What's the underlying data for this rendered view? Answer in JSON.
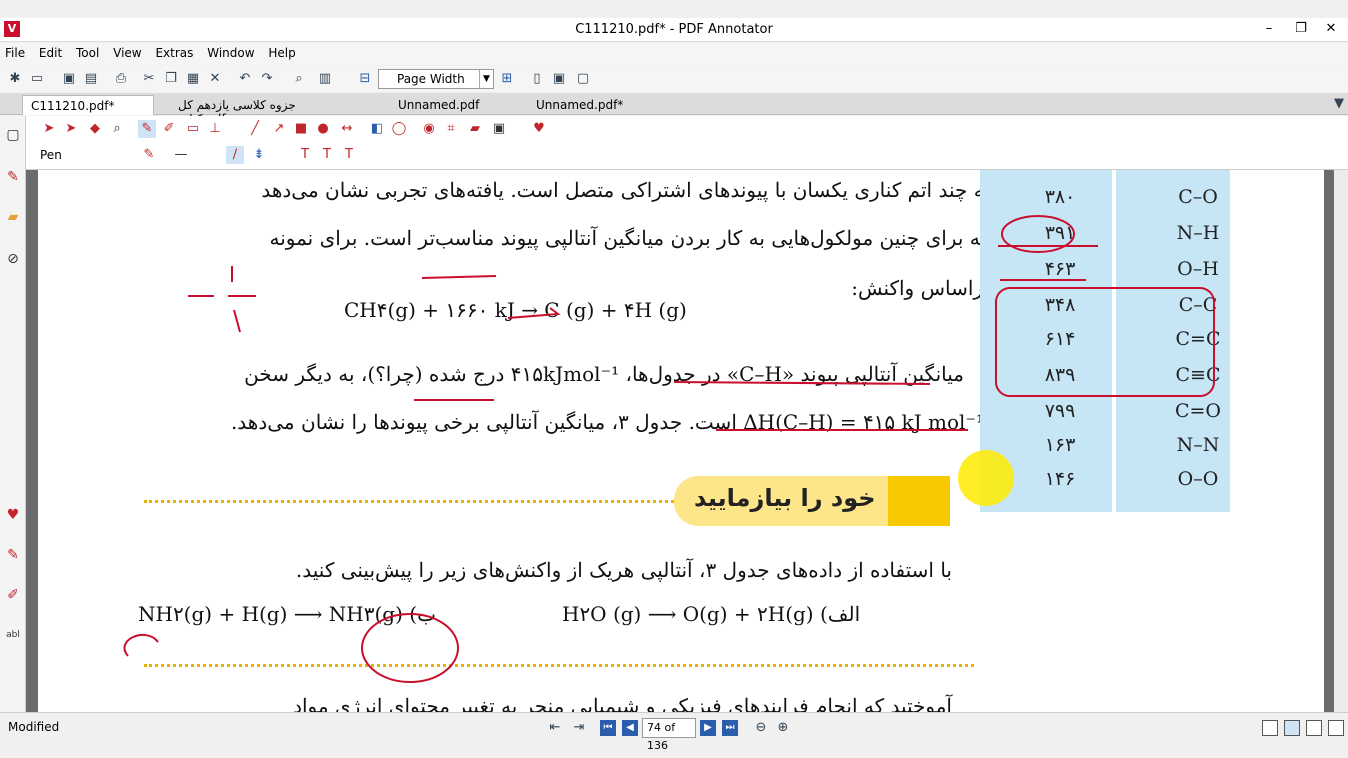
{
  "window": {
    "title": "C111210.pdf* - PDF Annotator",
    "minimize": "–",
    "maximize": "❐",
    "close": "✕"
  },
  "menu": [
    "File",
    "Edit",
    "Tool",
    "View",
    "Extras",
    "Window",
    "Help"
  ],
  "toolbar": {
    "zoom_value": "Page Width"
  },
  "tabs": [
    {
      "label": "C111210.pdf*",
      "active": true
    },
    {
      "label": "جزوه کلاسی یازدهم کل کتاب.pdf",
      "active": false
    },
    {
      "label": "Unnamed.pdf",
      "active": false
    },
    {
      "label": "Unnamed.pdf*",
      "active": false
    }
  ],
  "tool_label": "Pen",
  "page": {
    "line1": "به چند اتم کناری یکسان با پیوندهای اشتراکی متصل است. یافته‌های تجربی نشان می‌دهد",
    "line2": "که برای چنین مولکول‌هایی به کار بردن میانگین آنتالپی پیوند مناسب‌تر است. برای نمونه",
    "line3": "براساس واکنش:",
    "equation1": "CH۴(g) + ۱۶۶۰ kJ → C (g) + ۴H (g)",
    "line4": "میانگین آنتالپی پیوند «C–H» در جدول‌ها، ۴۱۵kJmol⁻¹ درج شده (چرا؟)، به دیگر سخن",
    "line5": "ΔH(C–H) = ۴۱۵ kJ mol⁻¹ است. جدول ۳، میانگین آنتالپی برخی پیوندها را نشان می‌دهد.",
    "banner": "خود را بیازمایید",
    "line6": "با استفاده از داده‌های جدول ۳، آنتالپی هریک از واکنش‌های زیر را پیش‌بینی کنید.",
    "eq_b": "NH۲(g) + H(g) ⟶ NH۳(g) (ب",
    "eq_a": "H۲O (g) ⟶ O(g) + ۲H(g) (الف",
    "line7": "آموختید که انجام فرایندهای فیزیکی و شیمیایی منجر به تغییر محتوای انرژی مواد"
  },
  "bond_table": [
    {
      "value": "۳۸۰",
      "bond": "C–O"
    },
    {
      "value": "۳۹۱",
      "bond": "N–H"
    },
    {
      "value": "۴۶۳",
      "bond": "O–H"
    },
    {
      "value": "۳۴۸",
      "bond": "C–C"
    },
    {
      "value": "۶۱۴",
      "bond": "C=C"
    },
    {
      "value": "۸۳۹",
      "bond": "C≡C"
    },
    {
      "value": "۷۹۹",
      "bond": "C=O"
    },
    {
      "value": "۱۶۳",
      "bond": "N–N"
    },
    {
      "value": "۱۴۶",
      "bond": "O–O"
    }
  ],
  "status": {
    "text": "Modified",
    "page_indicator": "74 of 136"
  },
  "colors": {
    "ink": "#c8102e",
    "table_bg": "#c6e6f6",
    "banner": "#fde68a"
  }
}
